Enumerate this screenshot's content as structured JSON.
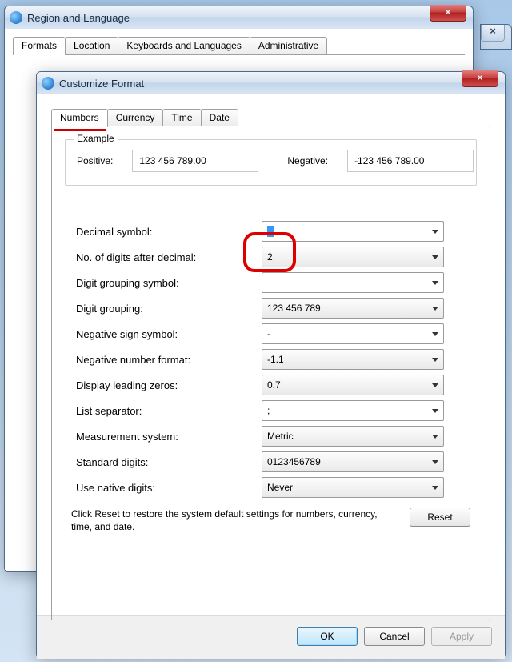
{
  "parent_window": {
    "title": "Region and Language",
    "tabs": [
      "Formats",
      "Location",
      "Keyboards and Languages",
      "Administrative"
    ],
    "active_tab": 0
  },
  "dialog": {
    "title": "Customize Format",
    "tabs": [
      "Numbers",
      "Currency",
      "Time",
      "Date"
    ],
    "active_tab": 0,
    "example": {
      "legend": "Example",
      "positive_label": "Positive:",
      "positive_value": "123 456 789.00",
      "negative_label": "Negative:",
      "negative_value": "-123 456 789.00"
    },
    "fields": {
      "decimal_symbol": {
        "label": "Decimal symbol:",
        "value": "."
      },
      "digits_after_decimal": {
        "label": "No. of digits after decimal:",
        "value": "2"
      },
      "digit_grouping_symbol": {
        "label": "Digit grouping symbol:",
        "value": ""
      },
      "digit_grouping": {
        "label": "Digit grouping:",
        "value": "123 456 789"
      },
      "negative_sign_symbol": {
        "label": "Negative sign symbol:",
        "value": "-"
      },
      "negative_number_format": {
        "label": "Negative number format:",
        "value": "-1.1"
      },
      "display_leading_zeros": {
        "label": "Display leading zeros:",
        "value": "0.7"
      },
      "list_separator": {
        "label": "List separator:",
        "value": ";"
      },
      "measurement_system": {
        "label": "Measurement system:",
        "value": "Metric"
      },
      "standard_digits": {
        "label": "Standard digits:",
        "value": "0123456789"
      },
      "use_native_digits": {
        "label": "Use native digits:",
        "value": "Never"
      }
    },
    "reset_note": "Click Reset to restore the system default settings for numbers, currency, time, and date.",
    "buttons": {
      "reset": "Reset",
      "ok": "OK",
      "cancel": "Cancel",
      "apply": "Apply"
    }
  }
}
